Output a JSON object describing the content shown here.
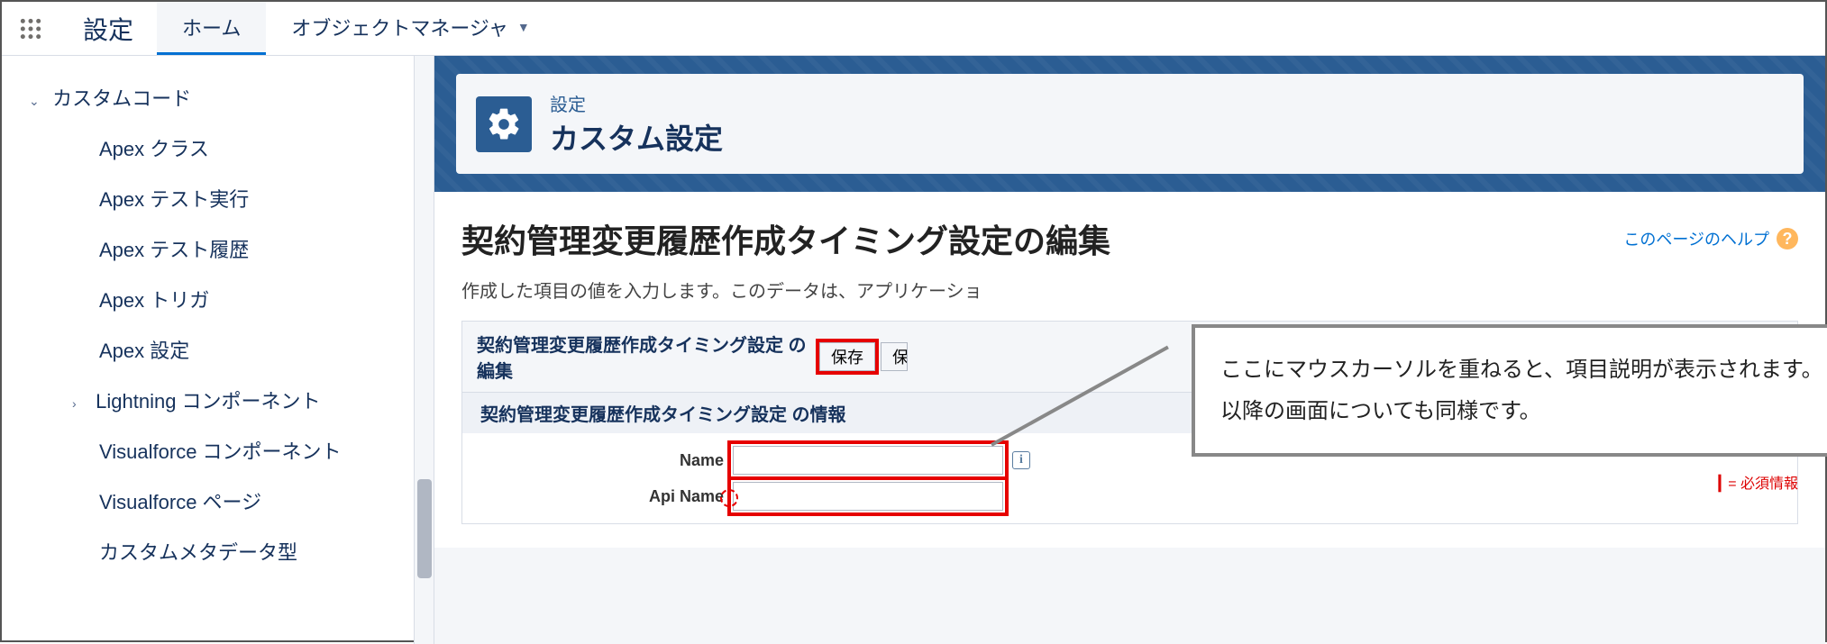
{
  "topbar": {
    "app_name": "設定",
    "tabs": [
      {
        "label": "ホーム",
        "active": true
      },
      {
        "label": "オブジェクトマネージャ",
        "active": false,
        "dropdown": true
      }
    ]
  },
  "sidebar": {
    "parent_label": "カスタムコード",
    "items": [
      "Apex クラス",
      "Apex テスト実行",
      "Apex テスト履歴",
      "Apex トリガ",
      "Apex 設定"
    ],
    "subparent_label": "Lightning コンポーネント",
    "items2": [
      "Visualforce コンポーネント",
      "Visualforce ページ",
      "カスタムメタデータ型"
    ]
  },
  "header": {
    "eyebrow": "設定",
    "title": "カスタム設定"
  },
  "page": {
    "title": "契約管理変更履歴作成タイミング設定の編集",
    "help_link": "このページのヘルプ",
    "description_prefix": "作成した項目の値を入力します。このデータは、アプリケーショ"
  },
  "section": {
    "title": "契約管理変更履歴作成タイミング設定 の編集",
    "save_label": "保存",
    "save_and_label": "保",
    "sub_title": "契約管理変更履歴作成タイミング設定 の情報",
    "required_hint": "= 必須情報"
  },
  "form": {
    "name_label": "Name",
    "api_name_label": "Api Name",
    "name_value": "",
    "api_name_value": ""
  },
  "callout": {
    "line1": "ここにマウスカーソルを重ねると、項目説明が表示されます。",
    "line2": "以降の画面についても同様です。"
  }
}
